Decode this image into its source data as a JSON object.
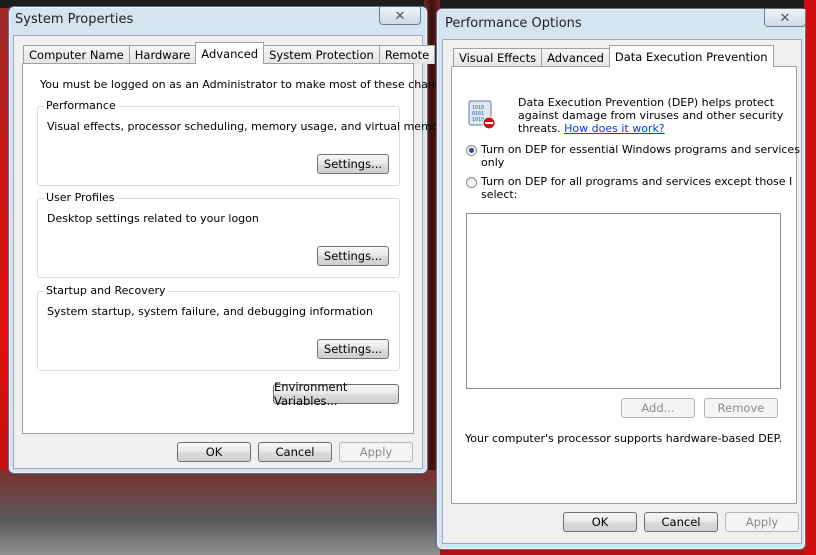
{
  "system_properties": {
    "title": "System Properties",
    "tabs": [
      "Computer Name",
      "Hardware",
      "Advanced",
      "System Protection",
      "Remote"
    ],
    "admin_note": "You must be logged on as an Administrator to make most of these changes.",
    "performance": {
      "label": "Performance",
      "desc": "Visual effects, processor scheduling, memory usage, and virtual memory",
      "button": "Settings..."
    },
    "user_profiles": {
      "label": "User Profiles",
      "desc": "Desktop settings related to your logon",
      "button": "Settings..."
    },
    "startup_recovery": {
      "label": "Startup and Recovery",
      "desc": "System startup, system failure, and debugging information",
      "button": "Settings..."
    },
    "env_button": "Environment Variables...",
    "ok": "OK",
    "cancel": "Cancel",
    "apply": "Apply"
  },
  "performance_options": {
    "title": "Performance Options",
    "tabs": [
      "Visual Effects",
      "Advanced",
      "Data Execution Prevention"
    ],
    "intro_line1": "Data Execution Prevention (DEP) helps protect",
    "intro_line2": "against damage from viruses and other security",
    "intro_line3": "threats.",
    "help_link": "How does it work?",
    "option1_line1": "Turn on DEP for essential Windows programs and services",
    "option1_line2": "only",
    "option2_line1": "Turn on DEP for all programs and services except those I",
    "option2_line2": "select:",
    "add": "Add...",
    "remove": "Remove",
    "support_note": "Your computer's processor supports hardware-based DEP.",
    "ok": "OK",
    "cancel": "Cancel",
    "apply": "Apply"
  },
  "icons": {
    "close": "close-icon",
    "dep": "dep-shield-icon"
  },
  "colors": {
    "accent": "#1f4f9a",
    "link": "#0044cc",
    "window_frame": "#d6e3f1",
    "background_red": "#e01010"
  }
}
